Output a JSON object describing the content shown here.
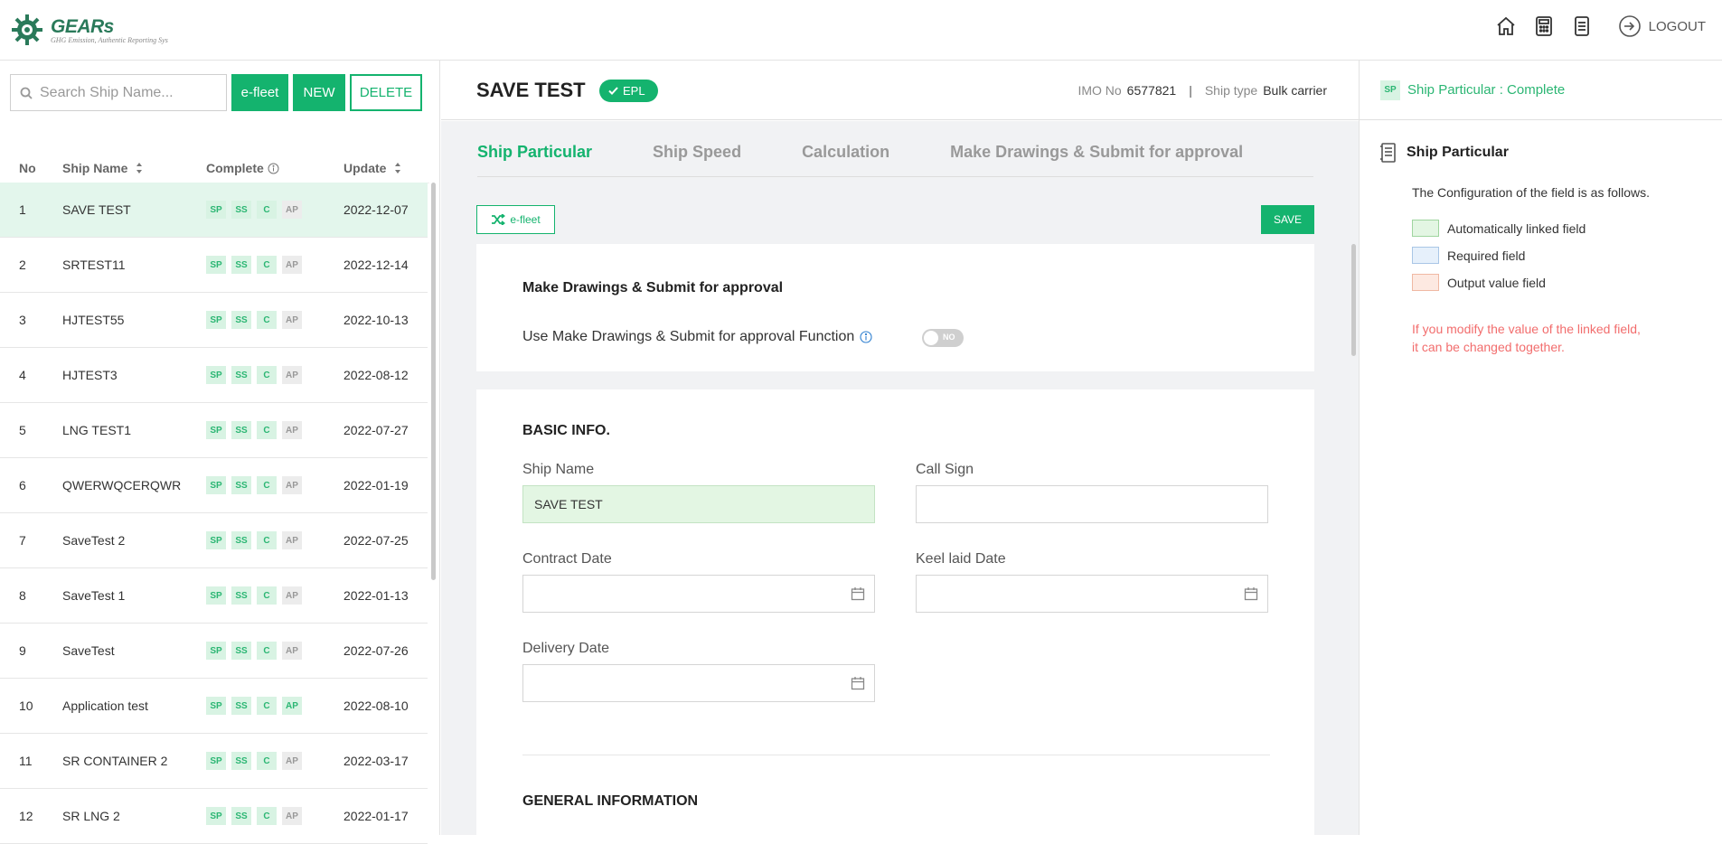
{
  "header": {
    "brand": "GEARs",
    "tagline": "GHG Emission, Authentic Reporting Sys",
    "logout_label": "LOGOUT"
  },
  "sidebar": {
    "search_placeholder": "Search Ship Name...",
    "efleet_label": "e-fleet",
    "new_label": "NEW",
    "delete_label": "DELETE",
    "columns": {
      "no": "No",
      "name": "Ship Name",
      "complete": "Complete",
      "update": "Update"
    },
    "ships": [
      {
        "no": "1",
        "name": "SAVE TEST",
        "update": "2022-12-07",
        "ap": false,
        "selected": true
      },
      {
        "no": "2",
        "name": "SRTEST11",
        "update": "2022-12-14",
        "ap": false
      },
      {
        "no": "3",
        "name": "HJTEST55",
        "update": "2022-10-13",
        "ap": false
      },
      {
        "no": "4",
        "name": "HJTEST3",
        "update": "2022-08-12",
        "ap": false
      },
      {
        "no": "5",
        "name": "LNG TEST1",
        "update": "2022-07-27",
        "ap": false
      },
      {
        "no": "6",
        "name": "QWERWQCERQWR",
        "update": "2022-01-19",
        "ap": false
      },
      {
        "no": "7",
        "name": "SaveTest 2",
        "update": "2022-07-25",
        "ap": false
      },
      {
        "no": "8",
        "name": "SaveTest 1",
        "update": "2022-01-13",
        "ap": false
      },
      {
        "no": "9",
        "name": "SaveTest",
        "update": "2022-07-26",
        "ap": false
      },
      {
        "no": "10",
        "name": "Application test",
        "update": "2022-08-10",
        "ap": true
      },
      {
        "no": "11",
        "name": "SR CONTAINER 2",
        "update": "2022-03-17",
        "ap": false
      },
      {
        "no": "12",
        "name": "SR LNG 2",
        "update": "2022-01-17",
        "ap": false
      }
    ],
    "badges": [
      "SP",
      "SS",
      "C",
      "AP"
    ]
  },
  "main": {
    "ship_title": "SAVE TEST",
    "epl_label": "EPL",
    "imo_label": "IMO No",
    "imo_value": "6577821",
    "separator": "|",
    "ship_type_label": "Ship type",
    "ship_type_value": "Bulk carrier",
    "tabs": [
      {
        "label": "Ship Particular"
      },
      {
        "label": "Ship Speed"
      },
      {
        "label": "Calculation"
      },
      {
        "label": "Make Drawings & Submit for approval"
      }
    ],
    "efleet_label": "e-fleet",
    "save_label": "SAVE",
    "drawings": {
      "title": "Make Drawings & Submit for approval",
      "function_label": "Use Make Drawings & Submit for approval Function",
      "toggle_value": "NO"
    },
    "basic_info": {
      "title": "BASIC INFO.",
      "ship_name_label": "Ship Name",
      "ship_name_value": "SAVE TEST",
      "call_sign_label": "Call Sign",
      "call_sign_value": "",
      "contract_date_label": "Contract Date",
      "keel_laid_label": "Keel laid Date",
      "delivery_date_label": "Delivery Date"
    },
    "general_info_title": "GENERAL INFORMATION"
  },
  "right": {
    "status_badge": "SP",
    "status_text": "Ship Particular : Complete",
    "title": "Ship Particular",
    "desc": "The Configuration of the field is as follows.",
    "legend": [
      {
        "label": "Automatically linked field",
        "fill": "#e3f6e3",
        "border": "#9fd59f"
      },
      {
        "label": "Required field",
        "fill": "#e6f0fb",
        "border": "#a9c6e6"
      },
      {
        "label": "Output value field",
        "fill": "#fde9e1",
        "border": "#f0b9a3"
      }
    ],
    "warning_line1": "If you modify the value of the linked field,",
    "warning_line2": "it can be changed together."
  },
  "colors": {
    "accent": "#14b36e",
    "warning": "#f26d6d"
  }
}
